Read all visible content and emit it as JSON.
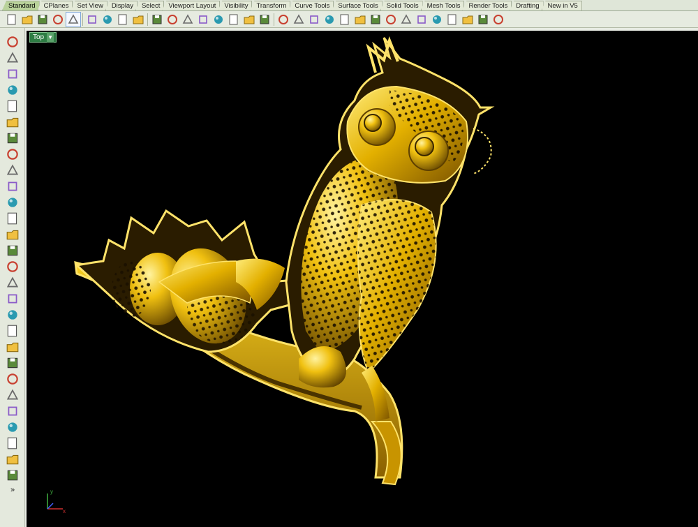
{
  "tabs": [
    {
      "label": "Standard",
      "active": true
    },
    {
      "label": "CPlanes"
    },
    {
      "label": "Set View"
    },
    {
      "label": "Display"
    },
    {
      "label": "Select"
    },
    {
      "label": "Viewport Layout"
    },
    {
      "label": "Visibility"
    },
    {
      "label": "Transform"
    },
    {
      "label": "Curve Tools"
    },
    {
      "label": "Surface Tools"
    },
    {
      "label": "Solid Tools"
    },
    {
      "label": "Mesh Tools"
    },
    {
      "label": "Render Tools"
    },
    {
      "label": "Drafting"
    },
    {
      "label": "New in V5"
    }
  ],
  "toolbar_icons": [
    "new-file-icon",
    "open-folder-icon",
    "save-icon",
    "print-icon",
    "blank-panel-icon",
    "cut-icon",
    "copy-icon",
    "paste-icon",
    "undo-icon",
    "pan-hand-icon",
    "rotate-view-icon",
    "zoom-icon",
    "zoom-window-icon",
    "zoom-extents-icon",
    "zoom-selected-icon",
    "zoom-all-icon",
    "four-viewports-icon",
    "car-select-icon",
    "hide-icon",
    "show-hide-icon",
    "point-icon",
    "lightbulb-icon",
    "lock-icon",
    "layer-icon",
    "color-wheel-icon",
    "shaded-sphere-icon",
    "rendered-sphere-icon",
    "render-sphere-icon",
    "flag-icon",
    "gear-options-icon",
    "ortho-icon",
    "help-icon"
  ],
  "left_tools": [
    "select-arrow-icon",
    "point-icon",
    "polyline-icon",
    "curve-points-icon",
    "circle-icon",
    "ellipse-icon",
    "polygon-icon",
    "rectangle-icon",
    "arc-icon",
    "curve-fillet-icon",
    "surface-icon",
    "extrude-icon",
    "box-icon",
    "sphere-icon",
    "cylinder-icon",
    "plane-icon",
    "boolean-icon",
    "explode-icon",
    "transform-icon",
    "array-icon",
    "chain-icon",
    "curve-tool-icon",
    "offset-icon",
    "text-icon",
    "dimension-icon",
    "group-icon",
    "copy-object-icon",
    "solid-box-icon"
  ],
  "left_more": "»",
  "viewport": {
    "name": "Top",
    "background": "#000000"
  },
  "axis": {
    "x": "x",
    "y": "y"
  },
  "colors": {
    "gold": "#e0b200",
    "gold_light": "#ffe36a",
    "gold_dark": "#6b4a00",
    "tab_active": "#b9d29a"
  }
}
